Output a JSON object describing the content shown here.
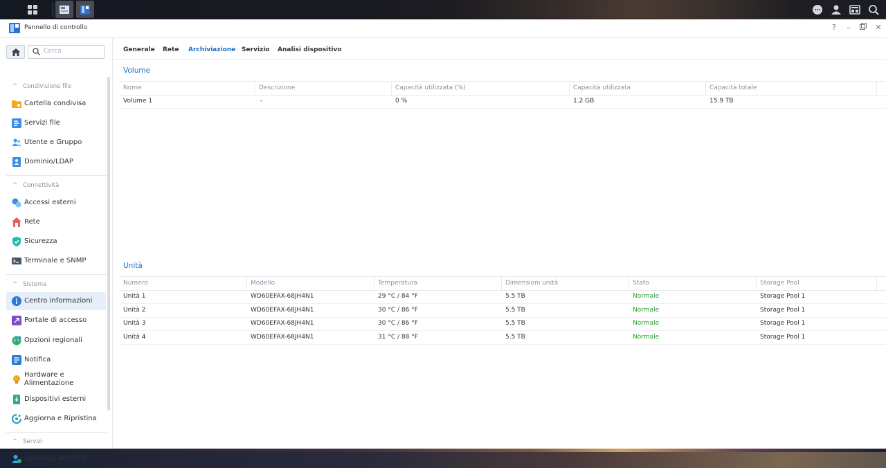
{
  "window": {
    "title": "Pannello di controllo"
  },
  "colors": {
    "accent": "#1b72c7",
    "status_ok": "#2a9c2a",
    "selected_bg": "#e6eef9"
  },
  "taskbar": {
    "icons": [
      "grid-icon",
      "package-center-icon",
      "control-panel-icon",
      "chat-icon",
      "user-icon",
      "widgets-icon",
      "search-icon"
    ]
  },
  "sidebar": {
    "search_placeholder": "Cerca",
    "sections": [
      {
        "label": "Condivisione file",
        "items": [
          {
            "label": "Cartella condivisa",
            "icon": "shared-folder-icon"
          },
          {
            "label": "Servizi file",
            "icon": "file-services-icon"
          },
          {
            "label": "Utente e Gruppo",
            "icon": "user-group-icon"
          },
          {
            "label": "Dominio/LDAP",
            "icon": "domain-ldap-icon"
          }
        ]
      },
      {
        "label": "Connettività",
        "items": [
          {
            "label": "Accessi esterni",
            "icon": "external-access-icon"
          },
          {
            "label": "Rete",
            "icon": "network-icon"
          },
          {
            "label": "Sicurezza",
            "icon": "shield-icon"
          },
          {
            "label": "Terminale e SNMP",
            "icon": "terminal-icon"
          }
        ]
      },
      {
        "label": "Sistema",
        "items": [
          {
            "label": "Centro informazioni",
            "icon": "info-icon",
            "selected": true
          },
          {
            "label": "Portale di accesso",
            "icon": "login-portal-icon"
          },
          {
            "label": "Opzioni regionali",
            "icon": "regional-icon"
          },
          {
            "label": "Notifica",
            "icon": "notification-icon"
          },
          {
            "label": "Hardware e Alimentazione",
            "icon": "bulb-icon"
          },
          {
            "label": "Dispositivi esterni",
            "icon": "external-device-icon"
          },
          {
            "label": "Aggiorna e Ripristina",
            "icon": "update-icon"
          }
        ]
      },
      {
        "label": "Servizi",
        "items": [
          {
            "label": "Synology Account",
            "icon": "synology-account-icon"
          }
        ]
      }
    ]
  },
  "tabs": [
    {
      "label": "Generale"
    },
    {
      "label": "Rete"
    },
    {
      "label": "Archiviazione",
      "active": true
    },
    {
      "label": "Servizio"
    },
    {
      "label": "Analisi dispositivo"
    }
  ],
  "volume": {
    "title": "Volume",
    "columns": [
      "Nome",
      "Descrizione",
      "Capacità utilizzata (%)",
      "Capacità utilizzata",
      "Capacità totale"
    ],
    "rows": [
      [
        "Volume 1",
        "-",
        "0 %",
        "1.2 GB",
        "15.9 TB"
      ]
    ]
  },
  "units": {
    "title": "Unità",
    "columns": [
      "Numero",
      "Modello",
      "Temperatura",
      "Dimensioni unità",
      "Stato",
      "Storage Pool"
    ],
    "rows": [
      [
        "Unità 1",
        "WD60EFAX-68JH4N1",
        "29 °C / 84 °F",
        "5.5 TB",
        "Normale",
        "Storage Pool 1"
      ],
      [
        "Unità 2",
        "WD60EFAX-68JH4N1",
        "30 °C / 86 °F",
        "5.5 TB",
        "Normale",
        "Storage Pool 1"
      ],
      [
        "Unità 3",
        "WD60EFAX-68JH4N1",
        "30 °C / 86 °F",
        "5.5 TB",
        "Normale",
        "Storage Pool 1"
      ],
      [
        "Unità 4",
        "WD60EFAX-68JH4N1",
        "31 °C / 88 °F",
        "5.5 TB",
        "Normale",
        "Storage Pool 1"
      ]
    ]
  }
}
